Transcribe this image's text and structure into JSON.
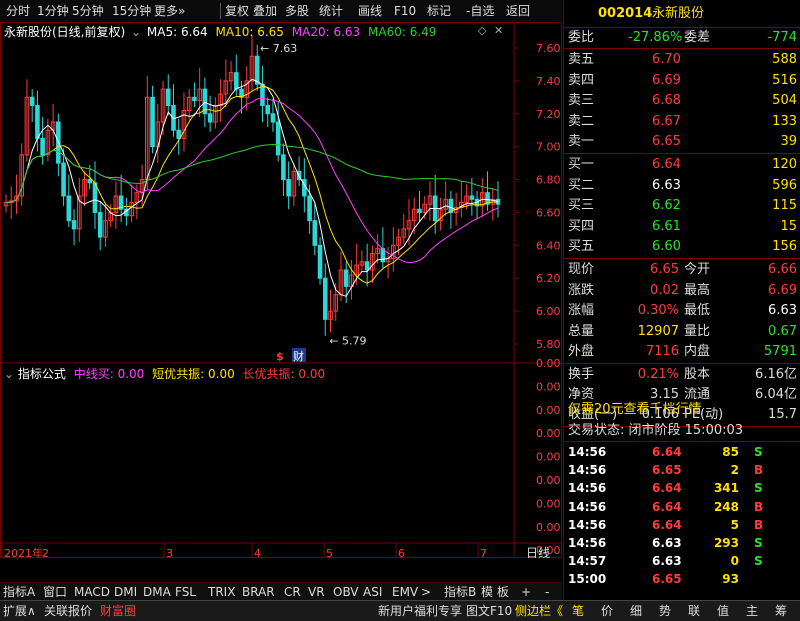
{
  "toolbar": {
    "items": [
      "分时",
      "1分钟",
      "5分钟",
      "15分钟",
      "更多»",
      "复权",
      "叠加",
      "多股",
      "统计",
      "画线",
      "F10",
      "标记",
      "-自选",
      "返回"
    ]
  },
  "chart": {
    "stock_title": "永新股份(日线,前复权)",
    "ma5": "MA5: 6.64",
    "ma10": "MA10: 6.65",
    "ma20": "MA20: 6.63",
    "ma60": "MA60: 6.49",
    "high_label": "7.63",
    "low_label": "5.79",
    "price_ticks": [
      "7.60",
      "7.40",
      "7.20",
      "7.00",
      "6.80",
      "6.60",
      "6.40",
      "6.20",
      "6.00",
      "5.80"
    ],
    "event_marks": [
      "$",
      "财"
    ],
    "indicator_title": "指标公式",
    "ind_mid": "中线买: 0.00",
    "ind_short": "短优共振: 0.00",
    "ind_long": "长优共振: 0.00",
    "ind_ticks": [
      "0.00",
      "0.00",
      "0.00",
      "0.00",
      "0.00",
      "0.00",
      "0.00",
      "0.00",
      "0.00",
      "0.00"
    ],
    "x_labels": [
      "2021年",
      "2",
      "3",
      "4",
      "5",
      "6",
      "7"
    ],
    "period": "日线"
  },
  "quote": {
    "code": "002014",
    "name": "永新股份",
    "webi_label": "委比",
    "webi_value": "-27.86%",
    "wecha_label": "委差",
    "wecha_value": "-774",
    "asks": [
      {
        "label": "卖五",
        "price": "6.70",
        "vol": "588"
      },
      {
        "label": "卖四",
        "price": "6.69",
        "vol": "516"
      },
      {
        "label": "卖三",
        "price": "6.68",
        "vol": "504"
      },
      {
        "label": "卖二",
        "price": "6.67",
        "vol": "133"
      },
      {
        "label": "卖一",
        "price": "6.65",
        "vol": "39"
      }
    ],
    "bids": [
      {
        "label": "买一",
        "price": "6.64",
        "vol": "120"
      },
      {
        "label": "买二",
        "price": "6.63",
        "vol": "596"
      },
      {
        "label": "买三",
        "price": "6.62",
        "vol": "115"
      },
      {
        "label": "买四",
        "price": "6.61",
        "vol": "15"
      },
      {
        "label": "买五",
        "price": "6.60",
        "vol": "156"
      }
    ],
    "stats": [
      {
        "l1": "现价",
        "v1": "6.65",
        "l2": "今开",
        "v2": "6.66"
      },
      {
        "l1": "涨跌",
        "v1": "0.02",
        "l2": "最高",
        "v2": "6.69"
      },
      {
        "l1": "涨幅",
        "v1": "0.30%",
        "l2": "最低",
        "v2": "6.63"
      },
      {
        "l1": "总量",
        "v1": "12907",
        "l2": "量比",
        "v2": "0.67"
      },
      {
        "l1": "外盘",
        "v1": "7116",
        "l2": "内盘",
        "v2": "5791"
      }
    ],
    "fin": [
      {
        "l1": "换手",
        "v1": "0.21%",
        "l2": "股本",
        "v2": "6.16亿"
      },
      {
        "l1": "净资",
        "v1": "3.15",
        "l2": "流通",
        "v2": "6.04亿"
      },
      {
        "l1": "收益(一)",
        "v1": "0.106",
        "l2": "PE(动)",
        "v2": "15.7"
      }
    ],
    "promo": "仅需20元查看千档行情",
    "trade_status": "交易状态: 闭市阶段 15:00:03",
    "ticks": [
      {
        "t": "14:56",
        "p": "6.64",
        "v": "85",
        "d": "S"
      },
      {
        "t": "14:56",
        "p": "6.65",
        "v": "2",
        "d": "B"
      },
      {
        "t": "14:56",
        "p": "6.64",
        "v": "341",
        "d": "S"
      },
      {
        "t": "14:56",
        "p": "6.64",
        "v": "248",
        "d": "B"
      },
      {
        "t": "14:56",
        "p": "6.64",
        "v": "5",
        "d": "B"
      },
      {
        "t": "14:56",
        "p": "6.63",
        "v": "293",
        "d": "S"
      },
      {
        "t": "14:57",
        "p": "6.63",
        "v": "0",
        "d": "S"
      },
      {
        "t": "15:00",
        "p": "6.65",
        "v": "93",
        "d": ""
      }
    ]
  },
  "tabs": [
    "指标A",
    "窗口",
    "MACD",
    "DMI",
    "DMA",
    "FSL",
    "TRIX",
    "BRAR",
    "CR",
    "VR",
    "OBV",
    "ASI",
    "EMV",
    ">",
    "指标B",
    "模 板",
    "+",
    "-"
  ],
  "status": {
    "left": [
      "扩展∧",
      "关联报价",
      "财富圈"
    ],
    "right": [
      "新用户福利专享",
      "图文F10",
      "侧边栏《"
    ],
    "right_tabs": [
      "笔",
      "价",
      "细",
      "势",
      "联",
      "值",
      "主",
      "筹"
    ]
  },
  "colors": {
    "up": "#ff3b3b",
    "down": "#2ee02e",
    "flat": "#ffffff",
    "ma5": "#ffffff",
    "ma10": "#ffe000",
    "ma20": "#ff40ff",
    "ma60": "#2ecc2e",
    "grid": "#7a0000"
  }
}
